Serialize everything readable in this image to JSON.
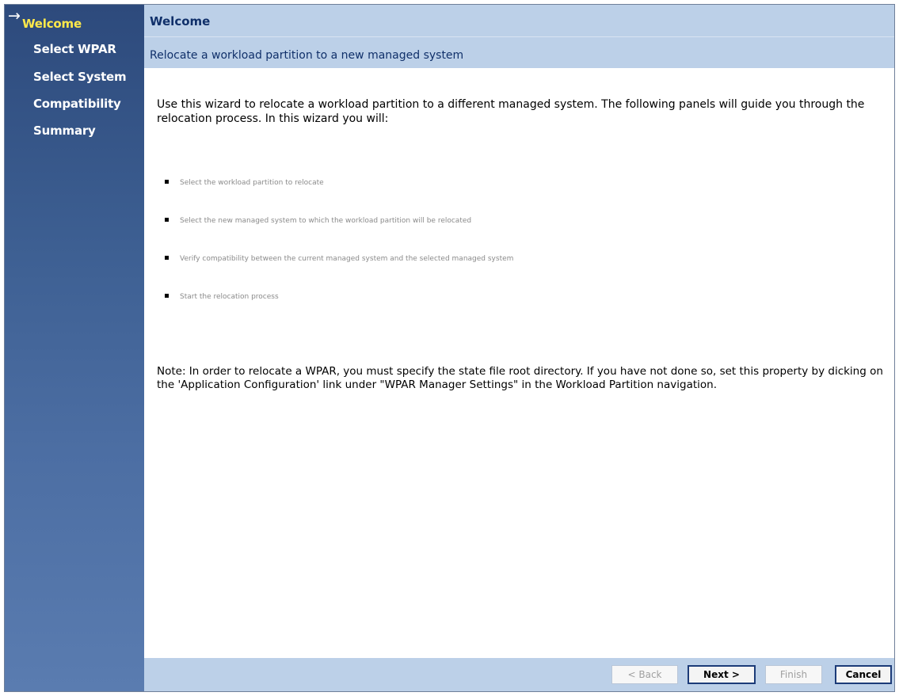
{
  "nav": {
    "items": [
      {
        "label": "Welcome",
        "active": true
      },
      {
        "label": "Select WPAR",
        "active": false
      },
      {
        "label": "Select System",
        "active": false
      },
      {
        "label": "Compatibility",
        "active": false
      },
      {
        "label": "Summary",
        "active": false
      }
    ],
    "current_icon": "arrow-right-icon"
  },
  "header": {
    "title": "Welcome",
    "subtitle": "Relocate a workload partition to a new managed system"
  },
  "content": {
    "intro": "Use this wizard to relocate a workload partition to a different managed system. The following panels will guide you through the relocation process. In this wizard you will:",
    "bullets": [
      "Select the workload partition to relocate",
      "Select the new managed system to which the workload partition will be relocated",
      "Verify compatibility between the current managed system and the selected managed system",
      "Start the relocation process"
    ],
    "note": "Note: In order to relocate a WPAR, you must specify the state file root directory. If you have not done so, set this property by dicking on the 'Application Configuration' link under \"WPAR Manager Settings\" in the Workload Partition navigation."
  },
  "footer": {
    "back_label": "< Back",
    "next_label": "Next >",
    "finish_label": "Finish",
    "cancel_label": "Cancel"
  },
  "colors": {
    "sidebar_top": "#2d4a7c",
    "sidebar_bottom": "#5a7cb0",
    "header_bg": "#bcd0e8",
    "active_nav": "#ffe94a"
  }
}
